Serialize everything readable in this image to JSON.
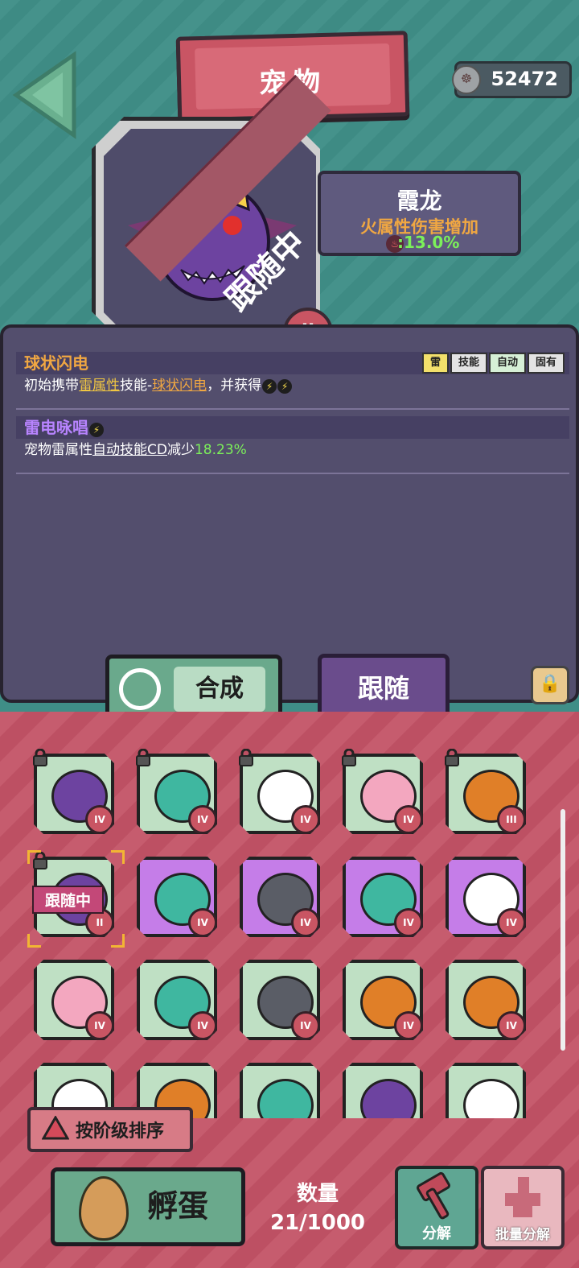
{
  "header": {
    "title": "宠物",
    "currency": "52472"
  },
  "pet": {
    "name": "霞龙",
    "effect": "火属性伤害增加",
    "value": ":13.0%",
    "follow_banner": "跟随中",
    "level": "II"
  },
  "skills": [
    {
      "name": "球状闪电",
      "tags": [
        "雷",
        "技能",
        "自动",
        "固有"
      ],
      "desc_parts": [
        "初始携带",
        "雷属性",
        "技能-",
        "球状闪电",
        "，并获得"
      ]
    },
    {
      "name": "雷电咏唱",
      "desc_parts": [
        "宠物雷属性",
        "自动技能CD",
        "减少",
        "18.23%"
      ]
    }
  ],
  "tabs": {
    "synthesize": "合成",
    "follow": "跟随"
  },
  "pet_cards": [
    {
      "bg": "green",
      "rank": "IV",
      "locked": true,
      "creature": "purple-dragon"
    },
    {
      "bg": "green",
      "rank": "IV",
      "locked": true,
      "creature": "teal-spring"
    },
    {
      "bg": "green",
      "rank": "IV",
      "locked": true,
      "creature": "skull-ghost"
    },
    {
      "bg": "green",
      "rank": "IV",
      "locked": true,
      "creature": "pink-fairy"
    },
    {
      "bg": "green",
      "rank": "III",
      "locked": true,
      "creature": "pumpkin-spider"
    },
    {
      "bg": "green",
      "rank": "II",
      "locked": true,
      "creature": "purple-dragon",
      "following": true
    },
    {
      "bg": "purple",
      "rank": "IV",
      "locked": false,
      "creature": "teal-spring"
    },
    {
      "bg": "purple",
      "rank": "IV",
      "locked": false,
      "creature": "mech-eye"
    },
    {
      "bg": "purple",
      "rank": "IV",
      "locked": false,
      "creature": "teal-spring"
    },
    {
      "bg": "purple",
      "rank": "IV",
      "locked": false,
      "creature": "skull-ghost"
    },
    {
      "bg": "green",
      "rank": "IV",
      "locked": false,
      "creature": "pink-fairy"
    },
    {
      "bg": "green",
      "rank": "IV",
      "locked": false,
      "creature": "teal-spring"
    },
    {
      "bg": "green",
      "rank": "IV",
      "locked": false,
      "creature": "mech-eye"
    },
    {
      "bg": "green",
      "rank": "IV",
      "locked": false,
      "creature": "pumpkin-spider"
    },
    {
      "bg": "green",
      "rank": "IV",
      "locked": false,
      "creature": "pumpkin-spider"
    },
    {
      "bg": "green",
      "rank": "",
      "locked": false,
      "creature": "skull-ghost"
    },
    {
      "bg": "green",
      "rank": "",
      "locked": false,
      "creature": "pumpkin-spider"
    },
    {
      "bg": "green",
      "rank": "",
      "locked": false,
      "creature": "teal-spring"
    },
    {
      "bg": "green",
      "rank": "",
      "locked": false,
      "creature": "purple-dragon"
    },
    {
      "bg": "green",
      "rank": "",
      "locked": false,
      "creature": "skull-ghost"
    }
  ],
  "following_tag": "跟随中",
  "sort_label": "按阶级排序",
  "hatch_label": "孵蛋",
  "count": {
    "label": "数量",
    "value": "21/1000"
  },
  "decompose_label": "分解",
  "batch_decompose_label": "批量分解",
  "colors": {
    "teal_bg": "#3f8e87",
    "panel": "#534e6d",
    "rose_bg": "#c35366",
    "card_green": "#bfe0c4",
    "card_purple": "#c57de8"
  }
}
